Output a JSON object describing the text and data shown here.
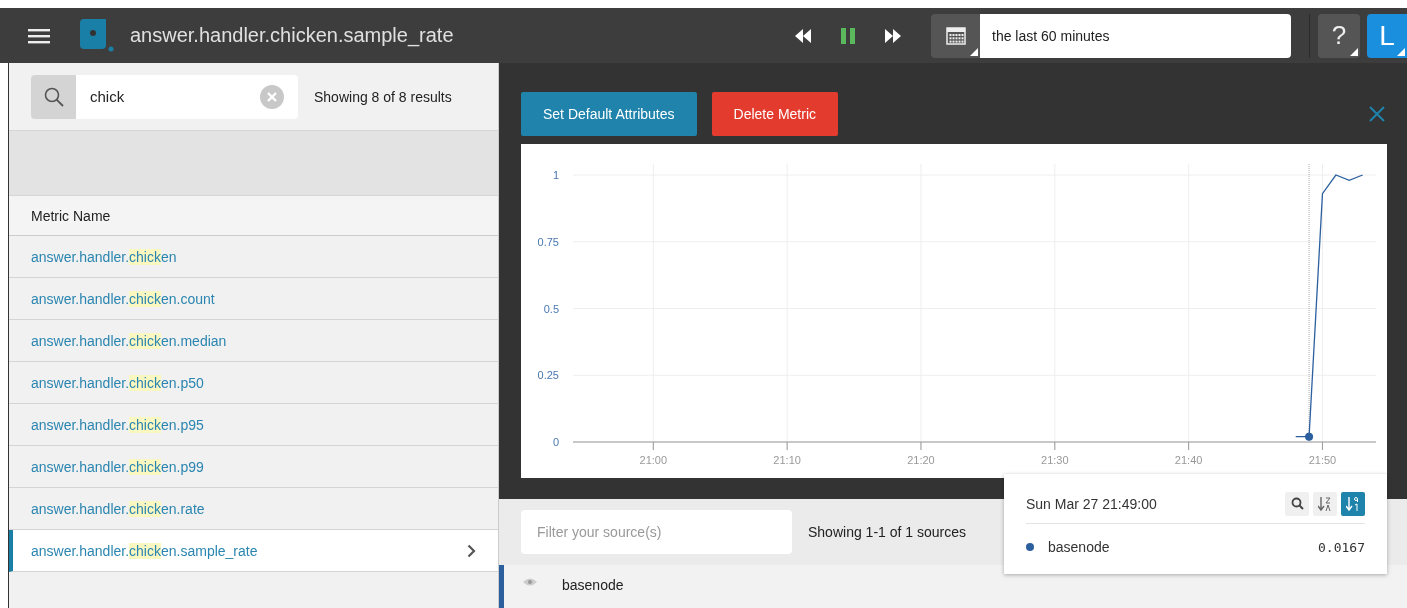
{
  "header": {
    "title": "answer.handler.chicken.sample_rate",
    "paused": true,
    "time_range": "the last 60 minutes",
    "help": "?",
    "user_initial": "L"
  },
  "search": {
    "value": "chick",
    "result_count": "Showing 8 of 8 results"
  },
  "metrics": {
    "column": "Metric Name",
    "rows": [
      {
        "before": "answer.handler.",
        "match": "chick",
        "after": "en",
        "selected": false
      },
      {
        "before": "answer.handler.",
        "match": "chick",
        "after": "en.count",
        "selected": false
      },
      {
        "before": "answer.handler.",
        "match": "chick",
        "after": "en.median",
        "selected": false
      },
      {
        "before": "answer.handler.",
        "match": "chick",
        "after": "en.p50",
        "selected": false
      },
      {
        "before": "answer.handler.",
        "match": "chick",
        "after": "en.p95",
        "selected": false
      },
      {
        "before": "answer.handler.",
        "match": "chick",
        "after": "en.p99",
        "selected": false
      },
      {
        "before": "answer.handler.",
        "match": "chick",
        "after": "en.rate",
        "selected": false
      },
      {
        "before": "answer.handler.",
        "match": "chick",
        "after": "en.sample_rate",
        "selected": true
      }
    ]
  },
  "actions": [
    {
      "label": "Set Default Attributes",
      "kind": "primary"
    },
    {
      "label": "Delete Metric",
      "kind": "danger"
    }
  ],
  "chart_data": {
    "type": "line",
    "grid": true,
    "ylim": [
      0,
      1
    ],
    "categories": [
      null,
      null,
      null,
      null,
      null,
      null,
      "21:00",
      null,
      null,
      null,
      null,
      null,
      null,
      null,
      null,
      null,
      "21:10",
      null,
      null,
      null,
      null,
      null,
      null,
      null,
      null,
      null,
      "21:20",
      null,
      null,
      null,
      null,
      null,
      null,
      null,
      null,
      null,
      "21:30",
      null,
      null,
      null,
      null,
      null,
      null,
      null,
      null,
      null,
      "21:40",
      null,
      null,
      null,
      null,
      null,
      null,
      null,
      null,
      null,
      "21:50",
      null,
      null,
      null,
      null
    ],
    "yticks": [
      0,
      0.25,
      0.5,
      0.75,
      1
    ],
    "series": [
      {
        "name": "basenode",
        "color": "#2b5f9e",
        "values": [
          null,
          null,
          null,
          null,
          null,
          null,
          null,
          null,
          null,
          null,
          null,
          null,
          null,
          null,
          null,
          null,
          null,
          null,
          null,
          null,
          null,
          null,
          null,
          null,
          null,
          null,
          null,
          null,
          null,
          null,
          null,
          null,
          null,
          null,
          null,
          null,
          null,
          null,
          null,
          null,
          null,
          null,
          null,
          null,
          null,
          null,
          null,
          null,
          null,
          null,
          null,
          null,
          null,
          null,
          0.02,
          0.02,
          0.93,
          1,
          0.98,
          1,
          null
        ]
      }
    ]
  },
  "hover": {
    "time": "Sun Mar 27 21:49:00",
    "sort_buttons": [
      {
        "kind": "alpha",
        "selected": false
      },
      {
        "kind": "numeric",
        "selected": true
      }
    ],
    "values": [
      "0.0167"
    ]
  },
  "sources": {
    "placeholder": "Filter your source(s)",
    "count": "Showing 1-1 of 1 sources",
    "rows": [
      {
        "name": "basenode",
        "visible": true
      }
    ]
  }
}
